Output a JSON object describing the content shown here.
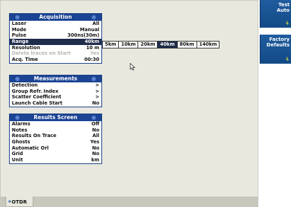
{
  "tab": {
    "label": "OTDR"
  },
  "acquisition": {
    "title": "Acquisition",
    "rows": [
      {
        "label": "Laser",
        "value": "All"
      },
      {
        "label": "Mode",
        "value": "Manual"
      },
      {
        "label": "Pulse",
        "value": "300ns(30m)"
      },
      {
        "label": "Range",
        "value": "40km"
      },
      {
        "label": "Resolution",
        "value": "10 m"
      },
      {
        "label": "Delete traces on Start",
        "value": "Yes"
      },
      {
        "label": "Acq. Time",
        "value": "00:30"
      }
    ]
  },
  "range_options": [
    "5km",
    "10km",
    "20km",
    "40km",
    "80km",
    "140km"
  ],
  "range_selected": "40km",
  "measurements": {
    "title": "Measurements",
    "rows": [
      {
        "label": "Detection",
        "value": ">"
      },
      {
        "label": "Group Refr. Index",
        "value": ">"
      },
      {
        "label": "Scatter Coefficient",
        "value": ">"
      },
      {
        "label": "Launch Cable Start",
        "value": "No"
      }
    ]
  },
  "results_screen": {
    "title": "Results Screen",
    "rows": [
      {
        "label": "Alarms",
        "value": "Off"
      },
      {
        "label": "Notes",
        "value": "No"
      },
      {
        "label": "Results On Trace",
        "value": "All"
      },
      {
        "label": "Ghosts",
        "value": "Yes"
      },
      {
        "label": "Automatic Orl",
        "value": "No"
      },
      {
        "label": "Grid",
        "value": "No"
      },
      {
        "label": "Unit",
        "value": "km"
      }
    ]
  },
  "side_buttons": [
    {
      "label": "Test\nAuto",
      "icon": "lightning-icon"
    },
    {
      "label": "Factory\nDefaults",
      "icon": "lightning-icon"
    }
  ],
  "colors": {
    "panel_header": "#1c4494",
    "selected_row": "#1f2d4b",
    "side_button": "#1f5c9f",
    "background": "#e8e8de"
  }
}
